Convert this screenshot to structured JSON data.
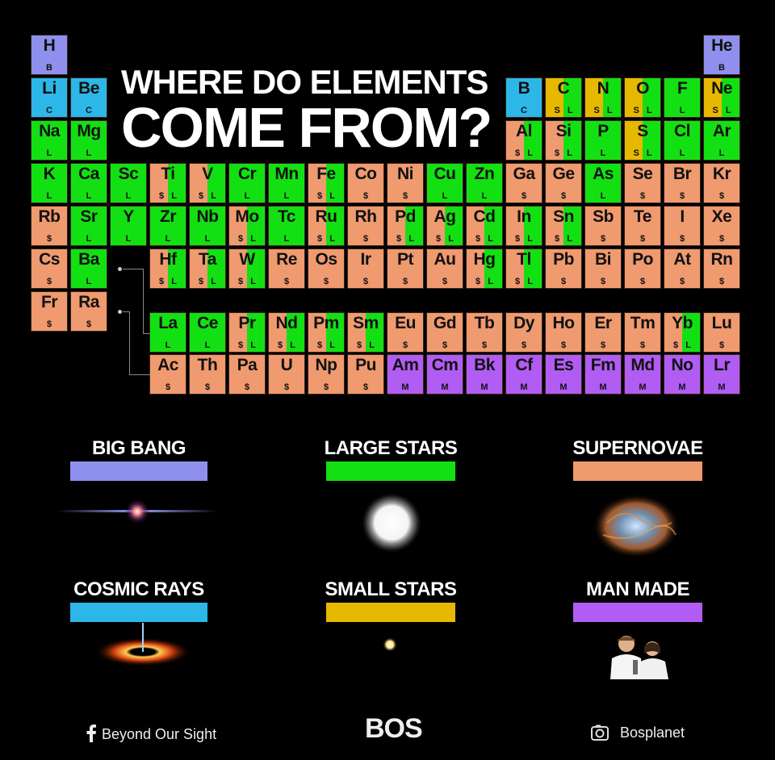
{
  "title": {
    "line1": "WHERE DO ELEMENTS",
    "line2": "COME FROM?"
  },
  "colors": {
    "B": "#8f8fee",
    "C": "#2db6e8",
    "S": "#e6b800",
    "L": "#13e013",
    "$": "#ef9a6f",
    "M": "#b15cf3"
  },
  "elements": [
    {
      "sym": "H",
      "row": 0,
      "col": 0,
      "src": [
        "B"
      ]
    },
    {
      "sym": "He",
      "row": 0,
      "col": 17,
      "src": [
        "B"
      ]
    },
    {
      "sym": "Li",
      "row": 1,
      "col": 0,
      "src": [
        "C"
      ]
    },
    {
      "sym": "Be",
      "row": 1,
      "col": 1,
      "src": [
        "C"
      ]
    },
    {
      "sym": "B",
      "row": 1,
      "col": 12,
      "src": [
        "C"
      ]
    },
    {
      "sym": "C",
      "row": 1,
      "col": 13,
      "src": [
        "S",
        "L"
      ]
    },
    {
      "sym": "N",
      "row": 1,
      "col": 14,
      "src": [
        "S",
        "L"
      ]
    },
    {
      "sym": "O",
      "row": 1,
      "col": 15,
      "src": [
        "S",
        "L"
      ]
    },
    {
      "sym": "F",
      "row": 1,
      "col": 16,
      "src": [
        "L"
      ]
    },
    {
      "sym": "Ne",
      "row": 1,
      "col": 17,
      "src": [
        "S",
        "L"
      ]
    },
    {
      "sym": "Na",
      "row": 2,
      "col": 0,
      "src": [
        "L"
      ]
    },
    {
      "sym": "Mg",
      "row": 2,
      "col": 1,
      "src": [
        "L"
      ]
    },
    {
      "sym": "Al",
      "row": 2,
      "col": 12,
      "src": [
        "$",
        "L"
      ]
    },
    {
      "sym": "Si",
      "row": 2,
      "col": 13,
      "src": [
        "$",
        "L"
      ]
    },
    {
      "sym": "P",
      "row": 2,
      "col": 14,
      "src": [
        "L"
      ]
    },
    {
      "sym": "S",
      "row": 2,
      "col": 15,
      "src": [
        "S",
        "L"
      ]
    },
    {
      "sym": "Cl",
      "row": 2,
      "col": 16,
      "src": [
        "L"
      ]
    },
    {
      "sym": "Ar",
      "row": 2,
      "col": 17,
      "src": [
        "L"
      ]
    },
    {
      "sym": "K",
      "row": 3,
      "col": 0,
      "src": [
        "L"
      ]
    },
    {
      "sym": "Ca",
      "row": 3,
      "col": 1,
      "src": [
        "L"
      ]
    },
    {
      "sym": "Sc",
      "row": 3,
      "col": 2,
      "src": [
        "L"
      ]
    },
    {
      "sym": "Ti",
      "row": 3,
      "col": 3,
      "src": [
        "$",
        "L"
      ]
    },
    {
      "sym": "V",
      "row": 3,
      "col": 4,
      "src": [
        "$",
        "L"
      ]
    },
    {
      "sym": "Cr",
      "row": 3,
      "col": 5,
      "src": [
        "L"
      ]
    },
    {
      "sym": "Mn",
      "row": 3,
      "col": 6,
      "src": [
        "L"
      ]
    },
    {
      "sym": "Fe",
      "row": 3,
      "col": 7,
      "src": [
        "$",
        "L"
      ]
    },
    {
      "sym": "Co",
      "row": 3,
      "col": 8,
      "src": [
        "$"
      ]
    },
    {
      "sym": "Ni",
      "row": 3,
      "col": 9,
      "src": [
        "$"
      ]
    },
    {
      "sym": "Cu",
      "row": 3,
      "col": 10,
      "src": [
        "L"
      ]
    },
    {
      "sym": "Zn",
      "row": 3,
      "col": 11,
      "src": [
        "L"
      ]
    },
    {
      "sym": "Ga",
      "row": 3,
      "col": 12,
      "src": [
        "$"
      ]
    },
    {
      "sym": "Ge",
      "row": 3,
      "col": 13,
      "src": [
        "$"
      ]
    },
    {
      "sym": "As",
      "row": 3,
      "col": 14,
      "src": [
        "L"
      ]
    },
    {
      "sym": "Se",
      "row": 3,
      "col": 15,
      "src": [
        "$"
      ]
    },
    {
      "sym": "Br",
      "row": 3,
      "col": 16,
      "src": [
        "$"
      ]
    },
    {
      "sym": "Kr",
      "row": 3,
      "col": 17,
      "src": [
        "$"
      ]
    },
    {
      "sym": "Rb",
      "row": 4,
      "col": 0,
      "src": [
        "$"
      ]
    },
    {
      "sym": "Sr",
      "row": 4,
      "col": 1,
      "src": [
        "L"
      ]
    },
    {
      "sym": "Y",
      "row": 4,
      "col": 2,
      "src": [
        "L"
      ]
    },
    {
      "sym": "Zr",
      "row": 4,
      "col": 3,
      "src": [
        "L"
      ]
    },
    {
      "sym": "Nb",
      "row": 4,
      "col": 4,
      "src": [
        "L"
      ]
    },
    {
      "sym": "Mo",
      "row": 4,
      "col": 5,
      "src": [
        "$",
        "L"
      ]
    },
    {
      "sym": "Tc",
      "row": 4,
      "col": 6,
      "src": [
        "L"
      ]
    },
    {
      "sym": "Ru",
      "row": 4,
      "col": 7,
      "src": [
        "$",
        "L"
      ]
    },
    {
      "sym": "Rh",
      "row": 4,
      "col": 8,
      "src": [
        "$"
      ]
    },
    {
      "sym": "Pd",
      "row": 4,
      "col": 9,
      "src": [
        "$",
        "L"
      ]
    },
    {
      "sym": "Ag",
      "row": 4,
      "col": 10,
      "src": [
        "$",
        "L"
      ]
    },
    {
      "sym": "Cd",
      "row": 4,
      "col": 11,
      "src": [
        "$",
        "L"
      ]
    },
    {
      "sym": "In",
      "row": 4,
      "col": 12,
      "src": [
        "$",
        "L"
      ]
    },
    {
      "sym": "Sn",
      "row": 4,
      "col": 13,
      "src": [
        "$",
        "L"
      ]
    },
    {
      "sym": "Sb",
      "row": 4,
      "col": 14,
      "src": [
        "$"
      ]
    },
    {
      "sym": "Te",
      "row": 4,
      "col": 15,
      "src": [
        "$"
      ]
    },
    {
      "sym": "I",
      "row": 4,
      "col": 16,
      "src": [
        "$"
      ]
    },
    {
      "sym": "Xe",
      "row": 4,
      "col": 17,
      "src": [
        "$"
      ]
    },
    {
      "sym": "Cs",
      "row": 5,
      "col": 0,
      "src": [
        "$"
      ]
    },
    {
      "sym": "Ba",
      "row": 5,
      "col": 1,
      "src": [
        "L"
      ]
    },
    {
      "sym": "Hf",
      "row": 5,
      "col": 3,
      "src": [
        "$",
        "L"
      ]
    },
    {
      "sym": "Ta",
      "row": 5,
      "col": 4,
      "src": [
        "$",
        "L"
      ]
    },
    {
      "sym": "W",
      "row": 5,
      "col": 5,
      "src": [
        "$",
        "L"
      ]
    },
    {
      "sym": "Re",
      "row": 5,
      "col": 6,
      "src": [
        "$"
      ]
    },
    {
      "sym": "Os",
      "row": 5,
      "col": 7,
      "src": [
        "$"
      ]
    },
    {
      "sym": "Ir",
      "row": 5,
      "col": 8,
      "src": [
        "$"
      ]
    },
    {
      "sym": "Pt",
      "row": 5,
      "col": 9,
      "src": [
        "$"
      ]
    },
    {
      "sym": "Au",
      "row": 5,
      "col": 10,
      "src": [
        "$"
      ]
    },
    {
      "sym": "Hg",
      "row": 5,
      "col": 11,
      "src": [
        "$",
        "L"
      ]
    },
    {
      "sym": "Tl",
      "row": 5,
      "col": 12,
      "src": [
        "$",
        "L"
      ]
    },
    {
      "sym": "Pb",
      "row": 5,
      "col": 13,
      "src": [
        "$"
      ]
    },
    {
      "sym": "Bi",
      "row": 5,
      "col": 14,
      "src": [
        "$"
      ]
    },
    {
      "sym": "Po",
      "row": 5,
      "col": 15,
      "src": [
        "$"
      ]
    },
    {
      "sym": "At",
      "row": 5,
      "col": 16,
      "src": [
        "$"
      ]
    },
    {
      "sym": "Rn",
      "row": 5,
      "col": 17,
      "src": [
        "$"
      ]
    },
    {
      "sym": "Fr",
      "row": 6,
      "col": 0,
      "src": [
        "$"
      ]
    },
    {
      "sym": "Ra",
      "row": 6,
      "col": 1,
      "src": [
        "$"
      ]
    },
    {
      "sym": "La",
      "row": 7,
      "col": 3,
      "src": [
        "L"
      ]
    },
    {
      "sym": "Ce",
      "row": 7,
      "col": 4,
      "src": [
        "L"
      ]
    },
    {
      "sym": "Pr",
      "row": 7,
      "col": 5,
      "src": [
        "$",
        "L"
      ]
    },
    {
      "sym": "Nd",
      "row": 7,
      "col": 6,
      "src": [
        "$",
        "L"
      ]
    },
    {
      "sym": "Pm",
      "row": 7,
      "col": 7,
      "src": [
        "$",
        "L"
      ]
    },
    {
      "sym": "Sm",
      "row": 7,
      "col": 8,
      "src": [
        "$",
        "L"
      ]
    },
    {
      "sym": "Eu",
      "row": 7,
      "col": 9,
      "src": [
        "$"
      ]
    },
    {
      "sym": "Gd",
      "row": 7,
      "col": 10,
      "src": [
        "$"
      ]
    },
    {
      "sym": "Tb",
      "row": 7,
      "col": 11,
      "src": [
        "$"
      ]
    },
    {
      "sym": "Dy",
      "row": 7,
      "col": 12,
      "src": [
        "$"
      ]
    },
    {
      "sym": "Ho",
      "row": 7,
      "col": 13,
      "src": [
        "$"
      ]
    },
    {
      "sym": "Er",
      "row": 7,
      "col": 14,
      "src": [
        "$"
      ]
    },
    {
      "sym": "Tm",
      "row": 7,
      "col": 15,
      "src": [
        "$"
      ]
    },
    {
      "sym": "Yb",
      "row": 7,
      "col": 16,
      "src": [
        "$",
        "L"
      ]
    },
    {
      "sym": "Lu",
      "row": 7,
      "col": 17,
      "src": [
        "$"
      ]
    },
    {
      "sym": "Ac",
      "row": 8,
      "col": 3,
      "src": [
        "$"
      ]
    },
    {
      "sym": "Th",
      "row": 8,
      "col": 4,
      "src": [
        "$"
      ]
    },
    {
      "sym": "Pa",
      "row": 8,
      "col": 5,
      "src": [
        "$"
      ]
    },
    {
      "sym": "U",
      "row": 8,
      "col": 6,
      "src": [
        "$"
      ]
    },
    {
      "sym": "Np",
      "row": 8,
      "col": 7,
      "src": [
        "$"
      ]
    },
    {
      "sym": "Pu",
      "row": 8,
      "col": 8,
      "src": [
        "$"
      ]
    },
    {
      "sym": "Am",
      "row": 8,
      "col": 9,
      "src": [
        "M"
      ]
    },
    {
      "sym": "Cm",
      "row": 8,
      "col": 10,
      "src": [
        "M"
      ]
    },
    {
      "sym": "Bk",
      "row": 8,
      "col": 11,
      "src": [
        "M"
      ]
    },
    {
      "sym": "Cf",
      "row": 8,
      "col": 12,
      "src": [
        "M"
      ]
    },
    {
      "sym": "Es",
      "row": 8,
      "col": 13,
      "src": [
        "M"
      ]
    },
    {
      "sym": "Fm",
      "row": 8,
      "col": 14,
      "src": [
        "M"
      ]
    },
    {
      "sym": "Md",
      "row": 8,
      "col": 15,
      "src": [
        "M"
      ]
    },
    {
      "sym": "No",
      "row": 8,
      "col": 16,
      "src": [
        "M"
      ]
    },
    {
      "sym": "Lr",
      "row": 8,
      "col": 17,
      "src": [
        "M"
      ]
    }
  ],
  "legend": [
    {
      "label": "BIG BANG",
      "code": "B",
      "image": "big-bang-flare"
    },
    {
      "label": "LARGE STARS",
      "code": "L",
      "image": "large-star-glow"
    },
    {
      "label": "SUPERNOVAE",
      "code": "$",
      "image": "crab-nebula"
    },
    {
      "label": "COSMIC RAYS",
      "code": "C",
      "image": "black-hole-jet"
    },
    {
      "label": "SMALL STARS",
      "code": "S",
      "image": "small-star-dot"
    },
    {
      "label": "MAN MADE",
      "code": "M",
      "image": "scientists-photo"
    }
  ],
  "footer": {
    "facebook_icon": "facebook-f-icon",
    "facebook_label": "Beyond Our Sight",
    "brand": "BOS",
    "instagram_icon": "camera-icon",
    "instagram_label": "Bosplanet"
  }
}
